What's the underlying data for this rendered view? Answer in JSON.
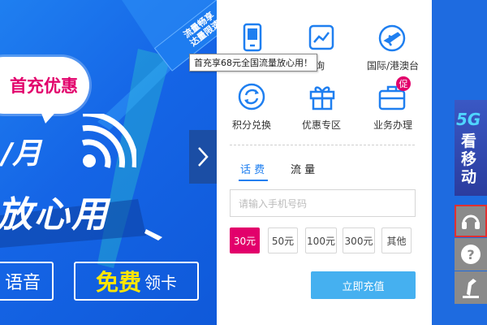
{
  "banner": {
    "ribbon_text_1": "流量畅享",
    "ribbon_text_2": "达量限速",
    "bubble_text": "首充优惠",
    "month_text": "/月",
    "headline": "放心用",
    "btn_left_label": "语音",
    "btn_right_highlight": "免费",
    "btn_right_label": "领卡"
  },
  "services": [
    {
      "label": "",
      "icon": "phone-icon"
    },
    {
      "label": "查询",
      "icon": "chart-icon"
    },
    {
      "label": "国际/港澳台",
      "icon": "airplane-icon"
    },
    {
      "label": "积分兑换",
      "icon": "refresh-icon"
    },
    {
      "label": "优惠专区",
      "icon": "gift-icon"
    },
    {
      "label": "业务办理",
      "icon": "briefcase-icon",
      "badge": "促"
    }
  ],
  "tooltip": "首充享68元全国流量放心用！",
  "tabs": [
    {
      "label": "话 费",
      "active": true
    },
    {
      "label": "流 量",
      "active": false
    }
  ],
  "phone_input": {
    "placeholder": "请输入手机号码"
  },
  "amounts": [
    "30元",
    "50元",
    "100元",
    "300元",
    "其他"
  ],
  "recharge_label": "立即充值",
  "side": {
    "promo_top": "5G",
    "promo_bottom": "看移动"
  },
  "colors": {
    "brand_blue": "#1f7ff0",
    "accent_pink": "#e2006b",
    "button_blue": "#45b0f0"
  }
}
